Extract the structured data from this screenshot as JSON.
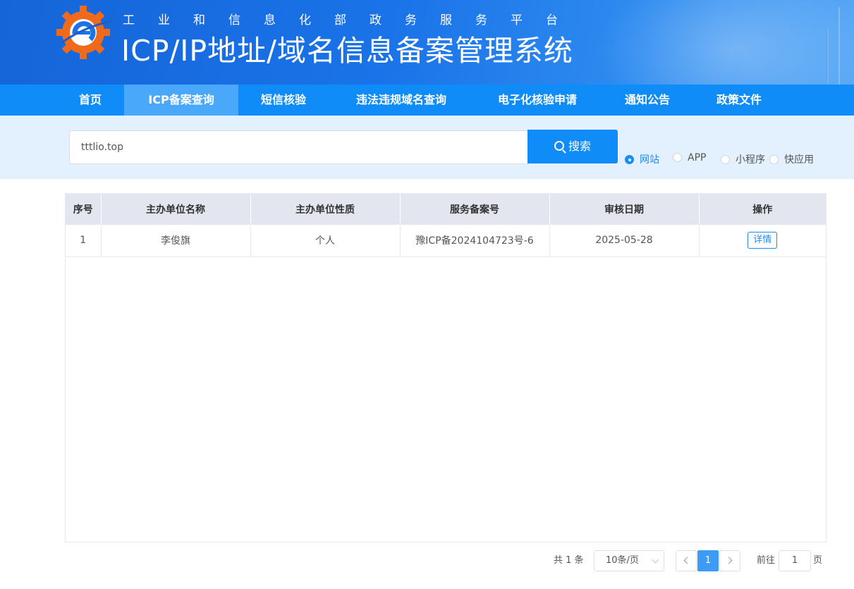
{
  "header": {
    "subtitle": "工业和信息化部政务服务平台",
    "title": "ICP/IP地址/域名信息备案管理系统"
  },
  "nav": {
    "items": [
      {
        "label": "首页",
        "active": false
      },
      {
        "label": "ICP备案查询",
        "active": true
      },
      {
        "label": "短信核验",
        "active": false
      },
      {
        "label": "违法违规域名查询",
        "active": false
      },
      {
        "label": "电子化核验申请",
        "active": false
      },
      {
        "label": "通知公告",
        "active": false
      },
      {
        "label": "政策文件",
        "active": false
      }
    ]
  },
  "search": {
    "value": "tttlio.top",
    "button_label": "搜索",
    "types": [
      {
        "label": "网站",
        "checked": true
      },
      {
        "label": "APP",
        "checked": false
      },
      {
        "label": "小程序",
        "checked": false
      },
      {
        "label": "快应用",
        "checked": false
      }
    ]
  },
  "table": {
    "columns": [
      "序号",
      "主办单位名称",
      "主办单位性质",
      "服务备案号",
      "审核日期",
      "操作"
    ],
    "rows": [
      {
        "index": "1",
        "name": "李俊旗",
        "nature": "个人",
        "license": "豫ICP备2024104723号-6",
        "date": "2025-05-28",
        "action": "详情"
      }
    ]
  },
  "pagination": {
    "total_text": "共 1 条",
    "page_size": "10条/页",
    "current_page": "1",
    "goto_label": "前往",
    "goto_value": "1",
    "goto_unit": "页"
  },
  "colors": {
    "primary": "#0f8cf7",
    "nav_active": "#4aa8fb",
    "search_bg": "#e3f0fd",
    "header_bg": "#e3e6ee"
  }
}
